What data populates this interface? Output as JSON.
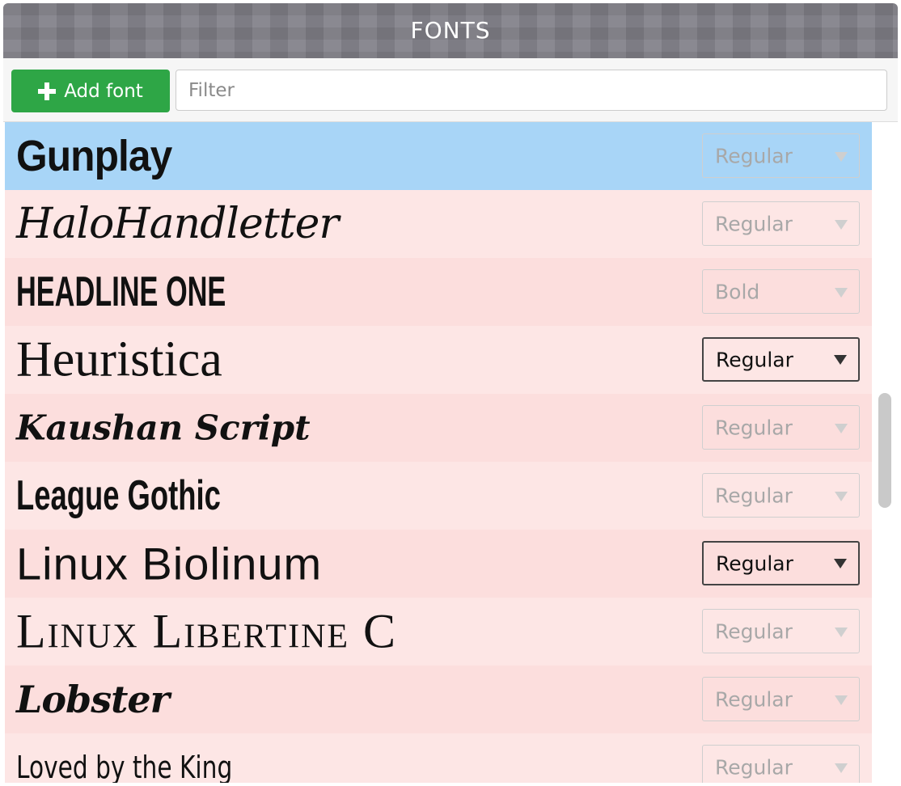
{
  "window": {
    "title": "FONTS"
  },
  "toolbar": {
    "add_font_label": "Add font",
    "filter_placeholder": "Filter",
    "filter_value": ""
  },
  "colors": {
    "selected_row": "#a8d5f7",
    "row_odd": "#fcdedd",
    "row_even": "#fde6e5",
    "add_button": "#2ea646"
  },
  "fonts": [
    {
      "name": "Gunplay",
      "style": "Regular",
      "selected": true,
      "style_active": false
    },
    {
      "name": "HaloHandletter",
      "style": "Regular",
      "selected": false,
      "style_active": false
    },
    {
      "name": "HEADLINE ONE",
      "style": "Bold",
      "selected": false,
      "style_active": false
    },
    {
      "name": "Heuristica",
      "style": "Regular",
      "selected": false,
      "style_active": true
    },
    {
      "name": "Kaushan Script",
      "style": "Regular",
      "selected": false,
      "style_active": false
    },
    {
      "name": "League Gothic",
      "style": "Regular",
      "selected": false,
      "style_active": false
    },
    {
      "name": "Linux Biolinum",
      "style": "Regular",
      "selected": false,
      "style_active": true
    },
    {
      "name": "Linux Libertine C",
      "style": "Regular",
      "selected": false,
      "style_active": false
    },
    {
      "name": "Lobster",
      "style": "Regular",
      "selected": false,
      "style_active": false
    },
    {
      "name": "Loved by the King",
      "style": "Regular",
      "selected": false,
      "style_active": false
    }
  ]
}
